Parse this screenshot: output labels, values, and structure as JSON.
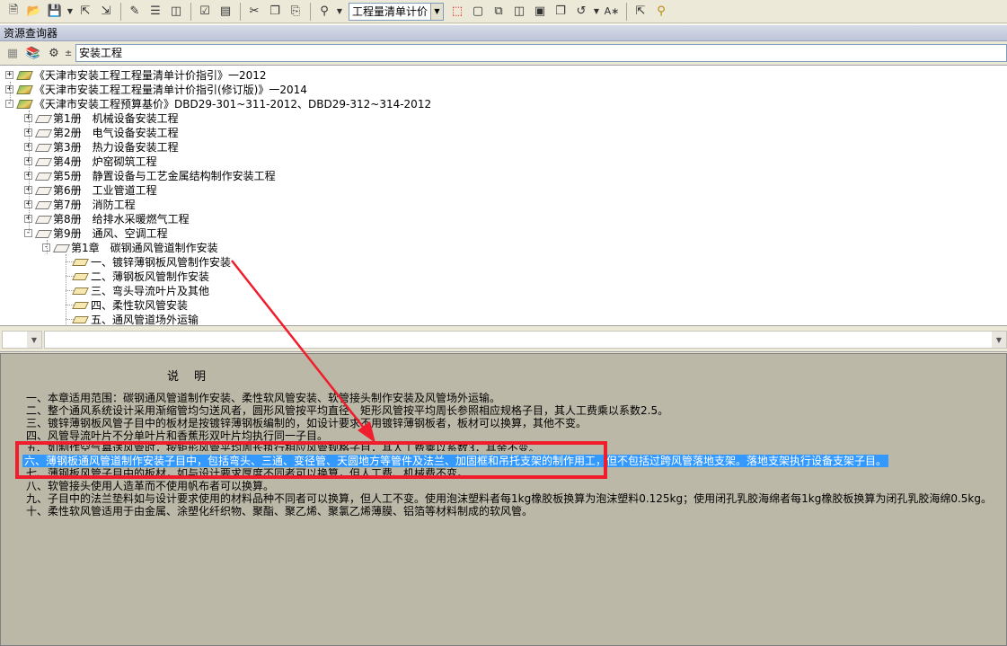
{
  "toolbar": {
    "combo_value": "工程量清单计价",
    "icons": [
      "new-file-icon",
      "open-folder-icon",
      "save-icon",
      "dropdown-arrow-icon",
      "export-icon",
      "import-icon",
      "document-edit-icon",
      "document-list-icon",
      "document-tree-icon",
      "checklist-icon",
      "print-preview-icon",
      "cut-icon",
      "copy-icon",
      "paste-icon",
      "find-icon",
      "dropdown-arrow-icon",
      "selection-frame-icon",
      "window-icon",
      "cascade-icon",
      "tile-icon",
      "minimize-all-icon",
      "restore-icon",
      "window-arrange-icon",
      "dropdown-arrow-icon",
      "text-style-icon",
      "select-pointer-icon",
      "help-icon"
    ]
  },
  "panel_title": "资源查询器",
  "resource_bar": {
    "input_value": "安装工程"
  },
  "tree": {
    "roots": [
      {
        "label": "《天津市安装工程工程量清单计价指引》一2012",
        "expander": "+"
      },
      {
        "label": "《天津市安装工程工程量清单计价指引(修订版)》一2014",
        "expander": "+"
      },
      {
        "label": "《天津市安装工程预算基价》DBD29-301~311-2012、DBD29-312~314-2012",
        "expander": "-"
      }
    ],
    "volumes": [
      {
        "label": "第1册　机械设备安装工程",
        "expander": "+"
      },
      {
        "label": "第2册　电气设备安装工程",
        "expander": "+"
      },
      {
        "label": "第3册　热力设备安装工程",
        "expander": "+"
      },
      {
        "label": "第4册　炉窑砌筑工程",
        "expander": "+"
      },
      {
        "label": "第5册　静置设备与工艺金属结构制作安装工程",
        "expander": "+"
      },
      {
        "label": "第6册　工业管道工程",
        "expander": "+"
      },
      {
        "label": "第7册　消防工程",
        "expander": "+"
      },
      {
        "label": "第8册　给排水采暖燃气工程",
        "expander": "+"
      },
      {
        "label": "第9册　通风、空调工程",
        "expander": "-"
      }
    ],
    "chapter": {
      "label": "第1章　碳钢通风管道制作安装",
      "expander": "-"
    },
    "sections": [
      "一、镀锌薄钢板风管制作安装",
      "二、薄钢板风管制作安装",
      "三、弯头导流叶片及其他",
      "四、柔性软风管安装",
      "五、通风管道场外运输"
    ]
  },
  "description": {
    "title": "说　明",
    "lines": [
      "一、本章适用范围：碳钢通风管道制作安装、柔性软风管安装、软管接头制作安装及风管场外运输。",
      "二、整个通风系统设计采用渐缩管均匀送风者，圆形风管按平均直径、矩形风管按平均周长参照相应规格子目，其人工费乘以系数2.5。",
      "三、镀锌薄钢板风管子目中的板材是按镀锌薄钢板编制的，如设计要求不用镀锌薄钢板者，板材可以换算，其他不变。",
      "四、风管导流叶片不分单叶片和香蕉形双叶片均执行同一子目。",
      "五、如制作空气幕送风管时，按矩形风管平均周长执行相应风管规格子目，其人工费乘以系数3，其余不变。",
      "六、薄钢板通风管道制作安装子目中，包括弯头、三通、变径管、天圆地方等管件及法兰、加固框和吊托支架的制作用工，但不包括过跨风管落地支架。落地支架执行设备支架子目。",
      "七、薄钢板风管子目中的板材，如与设计要求厚度不同者可以换算，但人工费、机械费不变。",
      "八、软管接头使用人造革而不使用帆布者可以换算。",
      "九、子目中的法兰垫料如与设计要求使用的材料品种不同者可以换算，但人工不变。使用泡沫塑料者每1kg橡胶板换算为泡沫塑料0.125kg；使用闭孔乳胶海绵者每1kg橡胶板换算为闭孔乳胶海绵0.5kg。",
      "十、柔性软风管适用于由金属、涂塑化纤织物、聚酯、聚乙烯、聚氯乙烯薄膜、铝箔等材料制成的软风管。"
    ],
    "selected_line_index": 5
  },
  "colors": {
    "selection": "#3399ff",
    "annotation_red": "#f01d2c",
    "text_panel_bg": "#bcb8a8"
  }
}
